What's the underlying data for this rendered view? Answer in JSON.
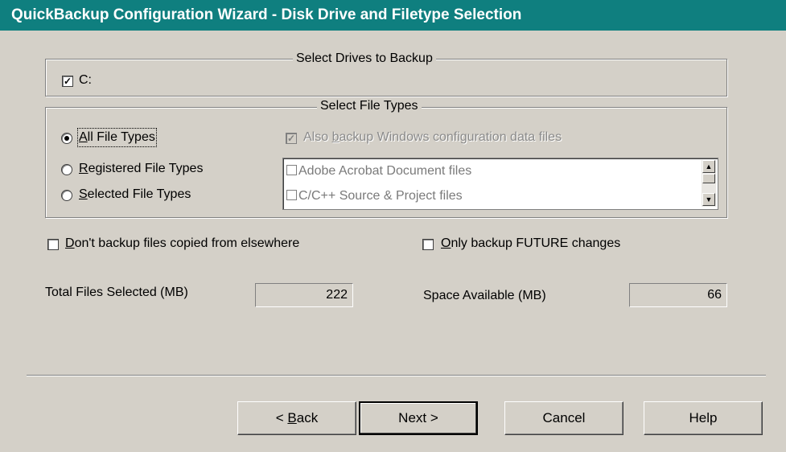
{
  "window": {
    "title": "QuickBackup Configuration Wizard - Disk Drive and Filetype Selection"
  },
  "drives": {
    "legend": "Select Drives to Backup",
    "items": [
      {
        "label": "C:",
        "checked": true
      }
    ]
  },
  "file_types": {
    "legend": "Select File Types",
    "options": [
      {
        "label": "All File Types",
        "mnemonic": "A",
        "rest": "ll File Types",
        "selected": true
      },
      {
        "label": "Registered File Types",
        "mnemonic": "R",
        "rest": "egistered File Types",
        "selected": false
      },
      {
        "label": "Selected File Types",
        "mnemonic": "S",
        "rest": "elected File Types",
        "selected": false
      }
    ],
    "also_backup": {
      "label": "Also backup Windows configuration data files",
      "pre": "Also ",
      "mnemonic": "b",
      "post": "ackup Windows configuration data files",
      "checked": true,
      "enabled": false
    },
    "list_items": [
      "Adobe Acrobat Document files",
      "C/C++ Source & Project files"
    ]
  },
  "options": {
    "dont_backup_copied": {
      "label": "Don't backup files copied from elsewhere",
      "mnemonic": "D",
      "rest": "on't backup files copied from elsewhere",
      "checked": false
    },
    "only_future": {
      "label": "Only backup FUTURE changes",
      "mnemonic": "O",
      "rest": "nly backup FUTURE changes",
      "checked": false
    }
  },
  "stats": {
    "total_label": "Total Files Selected (MB)",
    "total_value": "222",
    "space_label": "Space Available (MB)",
    "space_value": "66"
  },
  "buttons": {
    "back": {
      "arrow": "<",
      "mnemonic": "B",
      "rest": "ack"
    },
    "next": {
      "label": "Next",
      "arrow": ">"
    },
    "cancel": "Cancel",
    "help": "Help"
  }
}
